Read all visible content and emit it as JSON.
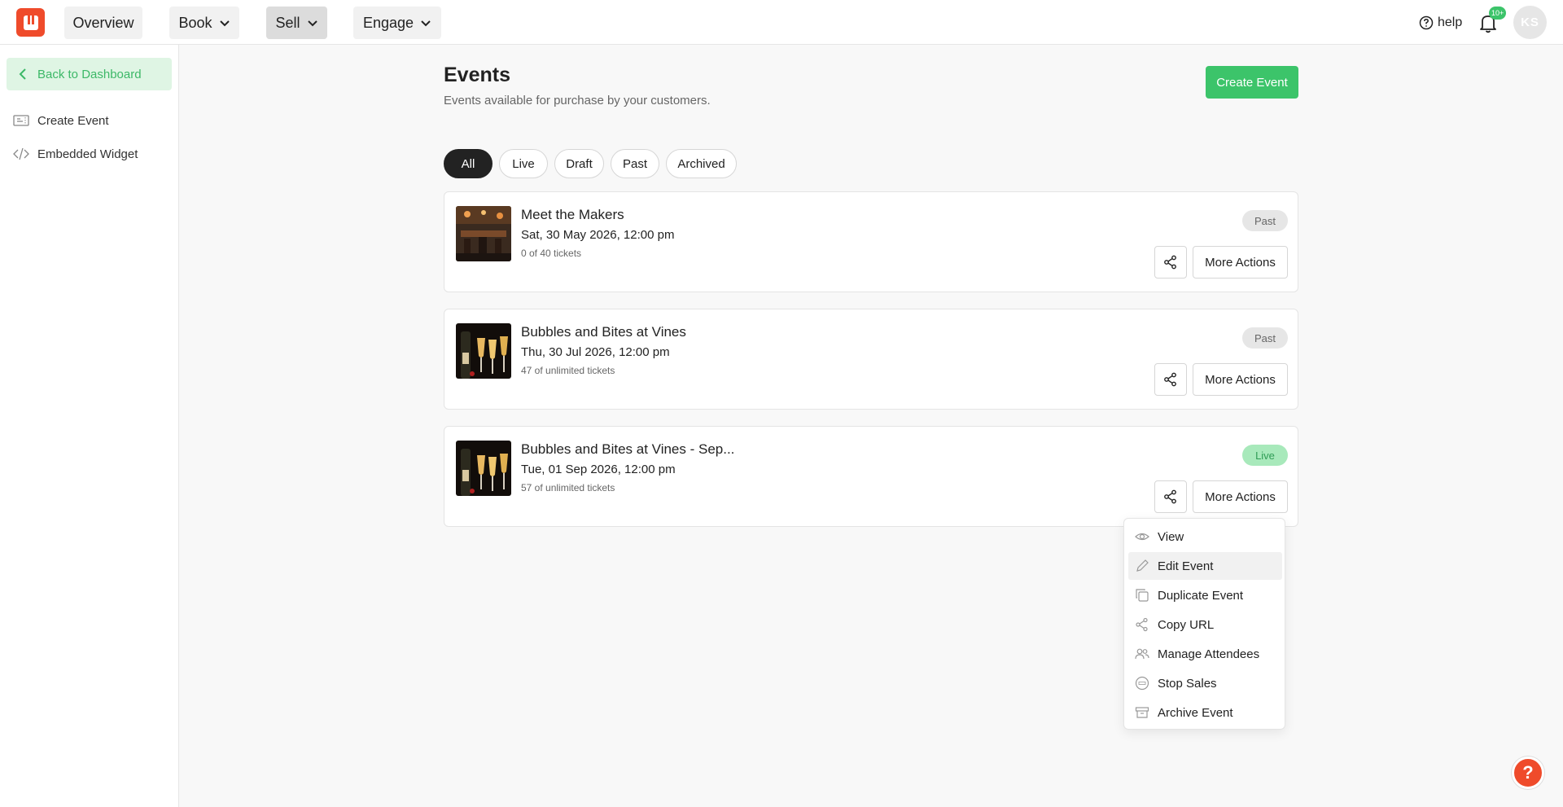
{
  "topbar": {
    "nav": [
      {
        "label": "Overview"
      },
      {
        "label": "Book"
      },
      {
        "label": "Sell"
      },
      {
        "label": "Engage"
      }
    ],
    "help_label": "help",
    "notifications_badge": "10+",
    "avatar_initials": "KS"
  },
  "sidebar": {
    "back_label": "Back to Dashboard",
    "items": [
      {
        "label": "Create Event",
        "icon": "ticket-icon"
      },
      {
        "label": "Embedded Widget",
        "icon": "code-icon"
      }
    ]
  },
  "main": {
    "title": "Events",
    "subtitle": "Events available for purchase by your customers.",
    "create_label": "Create Event",
    "filters": [
      "All",
      "Live",
      "Draft",
      "Past",
      "Archived"
    ],
    "active_filter": "All",
    "events": [
      {
        "title": "Meet the Makers",
        "date": "Sat, 30 May 2026, 12:00 pm",
        "tickets": "0 of 40 tickets",
        "status": "Past",
        "more_label": "More Actions"
      },
      {
        "title": "Bubbles and Bites at Vines",
        "date": "Thu, 30 Jul 2026, 12:00 pm",
        "tickets": "47 of unlimited tickets",
        "status": "Past",
        "more_label": "More Actions"
      },
      {
        "title": "Bubbles and Bites at Vines - Sep...",
        "date": "Tue, 01 Sep 2026, 12:00 pm",
        "tickets": "57 of unlimited tickets",
        "status": "Live",
        "more_label": "More Actions"
      }
    ]
  },
  "menu": {
    "items": [
      {
        "label": "View",
        "icon": "eye-icon"
      },
      {
        "label": "Edit Event",
        "icon": "pencil-icon"
      },
      {
        "label": "Duplicate Event",
        "icon": "copy-icon"
      },
      {
        "label": "Copy URL",
        "icon": "share-icon"
      },
      {
        "label": "Manage Attendees",
        "icon": "users-icon"
      },
      {
        "label": "Stop Sales",
        "icon": "stop-icon"
      },
      {
        "label": "Archive Event",
        "icon": "archive-icon"
      }
    ]
  },
  "help_fab_label": "?",
  "colors": {
    "brand": "#ef4b2b",
    "accent": "#3cc46a",
    "live_badge": "#a8e9bb"
  }
}
